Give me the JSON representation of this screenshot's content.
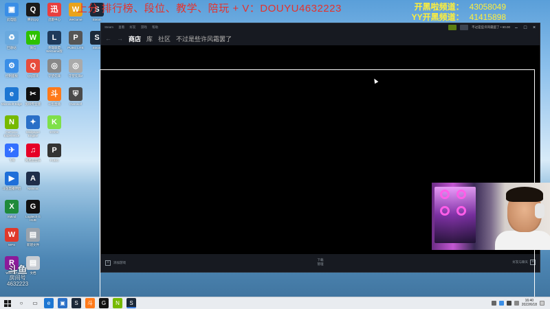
{
  "overlay": {
    "ad_prefix": "上",
    "ad_text": "上分  排行榜、段位、教学、陪玩 + V：DOUYU4632223",
    "channels": [
      {
        "label": "开黑啦频道：",
        "value": "43058049"
      },
      {
        "label": "YY开黑频道：",
        "value": "41415898"
      }
    ],
    "watermark_logo": "斗鱼",
    "watermark_text": "房间号",
    "watermark_id": "4632223"
  },
  "desktop_icons": [
    {
      "label": "此电脑",
      "icon": "computer-icon",
      "glyph": "▣",
      "color": "#3a8ee6"
    },
    {
      "label": "腾讯QQ",
      "icon": "qq-icon",
      "glyph": "Q",
      "color": "#1a1a1a"
    },
    {
      "label": "迅雷中心",
      "icon": "thunder-icon",
      "glyph": "迅",
      "color": "#e83f3f"
    },
    {
      "label": "WeGame",
      "icon": "wegame-icon",
      "glyph": "W",
      "color": "#e9a31b"
    },
    {
      "label": "Steam",
      "icon": "steam-icon",
      "glyph": "S",
      "color": "#1b2838"
    },
    {
      "label": "回收站",
      "icon": "recycle-bin-icon",
      "glyph": "♻",
      "color": "#6aa9de"
    },
    {
      "label": "微信",
      "icon": "wechat-icon",
      "glyph": "W",
      "color": "#2dc100"
    },
    {
      "label": "英雄联盟WeGame版",
      "icon": "lol-icon",
      "glyph": "L",
      "color": "#1f3a5a"
    },
    {
      "label": "PUBG LITE",
      "icon": "pubg-icon",
      "glyph": "P",
      "color": "#555"
    },
    {
      "label": "Steam",
      "icon": "steam2-icon",
      "glyph": "S",
      "color": "#1b2838"
    },
    {
      "label": "控制面板",
      "icon": "control-panel-icon",
      "glyph": "⚙",
      "color": "#3a8ee6"
    },
    {
      "label": "QQ游戏",
      "icon": "qqgame-icon",
      "glyph": "Q",
      "color": "#e74c3c"
    },
    {
      "label": "守望先锋",
      "icon": "overwatch-icon",
      "glyph": "◎",
      "color": "#888"
    },
    {
      "label": "守望先锋2",
      "icon": "overwatch2-icon",
      "glyph": "◎",
      "color": "#aaa"
    },
    {
      "label": "Microsoft Edge",
      "icon": "edge-icon",
      "glyph": "e",
      "color": "#1d76d2"
    },
    {
      "label": "剪映专业版",
      "icon": "capcut-icon",
      "glyph": "✂",
      "color": "#111"
    },
    {
      "label": "斗鱼直播",
      "icon": "douyu-icon",
      "glyph": "斗",
      "color": "#ff7a1a"
    },
    {
      "label": "Overwolf",
      "icon": "overwolf-icon",
      "glyph": "⛨",
      "color": "#4a4a4a"
    },
    {
      "label": "GeForce Experience",
      "icon": "nvidia-icon",
      "glyph": "N",
      "color": "#76b900"
    },
    {
      "label": "Wallpaper Engine",
      "icon": "wallpaper-engine-icon",
      "glyph": "✦",
      "color": "#2a6fc7"
    },
    {
      "label": "KOOK",
      "icon": "kook-icon",
      "glyph": "K",
      "color": "#7fe04a"
    },
    {
      "label": "飞书",
      "icon": "feishu-icon",
      "glyph": "✈",
      "color": "#3370ff"
    },
    {
      "label": "网易云音乐",
      "icon": "netease-music-icon",
      "glyph": "♫",
      "color": "#e60026"
    },
    {
      "label": "PUBG",
      "icon": "pubg2-icon",
      "glyph": "P",
      "color": "#333"
    },
    {
      "label": "斗鱼直播伴侣",
      "icon": "douyu-companion-icon",
      "glyph": "▶",
      "color": "#1e6fd9"
    },
    {
      "label": "Nahimic",
      "icon": "nahimic-icon",
      "glyph": "A",
      "color": "#1f2e4a"
    },
    {
      "label": "XMind",
      "icon": "xmind-icon",
      "glyph": "X",
      "color": "#1f8a3a"
    },
    {
      "label": "Logitech G HUB",
      "icon": "ghub-icon",
      "glyph": "G",
      "color": "#111"
    },
    {
      "label": "WPS",
      "icon": "wps-icon",
      "glyph": "W",
      "color": "#e0392b"
    },
    {
      "label": "新建文件",
      "icon": "file-icon",
      "glyph": "▤",
      "color": "#9aa3ad"
    },
    {
      "label": "WinRAR",
      "icon": "winrar-icon",
      "glyph": "R",
      "color": "#8b1a9a"
    },
    {
      "label": "文档",
      "icon": "document-icon",
      "glyph": "▤",
      "color": "#c7ccd2"
    }
  ],
  "steam": {
    "menu": [
      "Steam",
      "查看",
      "好友",
      "游戏",
      "帮助"
    ],
    "user": "不过是些许风霜罢了 • ¥0.00",
    "nav": {
      "store": "商店",
      "library": "库",
      "community": "社区",
      "username": "不过是些许风霜罢了"
    },
    "bottom": {
      "add_game": "添加游戏",
      "downloads": "下载",
      "downloads_sub": "管理",
      "friends": "好友与聊天"
    }
  },
  "taskbar": {
    "time": "16:40",
    "date": "2022/6/18"
  }
}
